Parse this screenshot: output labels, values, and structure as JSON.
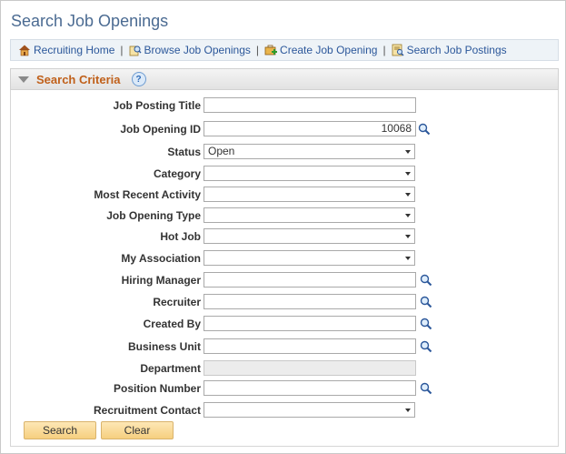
{
  "page": {
    "title": "Search Job Openings"
  },
  "nav": {
    "links": [
      {
        "label": "Recruiting Home",
        "icon": "home-icon"
      },
      {
        "label": "Browse Job Openings",
        "icon": "browse-icon"
      },
      {
        "label": "Create Job Opening",
        "icon": "create-icon"
      },
      {
        "label": "Search Job Postings",
        "icon": "search-postings-icon"
      }
    ],
    "separator": "|"
  },
  "section": {
    "title": "Search Criteria",
    "help_glyph": "?"
  },
  "fields": {
    "job_posting_title": {
      "label": "Job Posting Title",
      "value": ""
    },
    "job_opening_id": {
      "label": "Job Opening ID",
      "value": "10068"
    },
    "status": {
      "label": "Status",
      "value": "Open"
    },
    "category": {
      "label": "Category",
      "value": ""
    },
    "most_recent_activity": {
      "label": "Most Recent Activity",
      "value": ""
    },
    "job_opening_type": {
      "label": "Job Opening Type",
      "value": ""
    },
    "hot_job": {
      "label": "Hot Job",
      "value": ""
    },
    "my_association": {
      "label": "My Association",
      "value": ""
    },
    "hiring_manager": {
      "label": "Hiring Manager",
      "value": ""
    },
    "recruiter": {
      "label": "Recruiter",
      "value": ""
    },
    "created_by": {
      "label": "Created By",
      "value": ""
    },
    "business_unit": {
      "label": "Business Unit",
      "value": ""
    },
    "department": {
      "label": "Department",
      "value": ""
    },
    "position_number": {
      "label": "Position Number",
      "value": ""
    },
    "recruitment_contact": {
      "label": "Recruitment Contact",
      "value": ""
    }
  },
  "buttons": {
    "search": "Search",
    "clear": "Clear"
  },
  "colors": {
    "title": "#4b6b92",
    "link": "#2b579a",
    "section_title": "#c0601a",
    "button": "#f6cf7f"
  }
}
